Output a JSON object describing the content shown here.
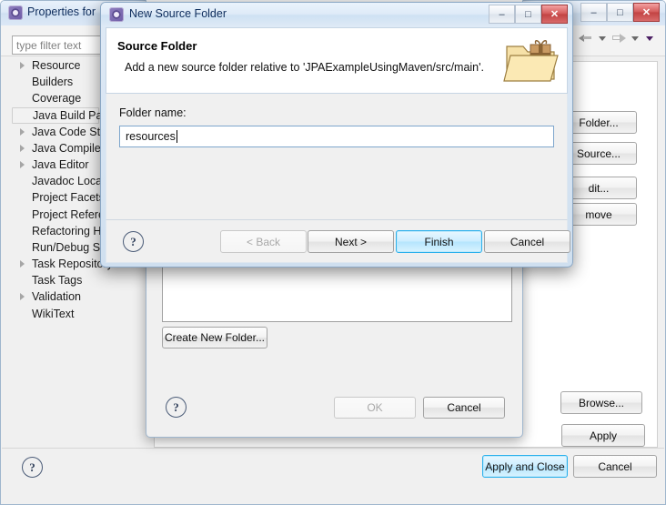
{
  "parent_window": {
    "title": "Properties for",
    "gear_icon": "gear-icon",
    "window_buttons": [
      {
        "name": "minimize",
        "glyph": "–"
      },
      {
        "name": "maximize",
        "glyph": "□"
      },
      {
        "name": "close",
        "glyph": "✕"
      }
    ],
    "toolbar": {
      "back_icon": "back-arrow-icon",
      "back_dropdown_icon": "chevron-down-icon",
      "forward_icon": "forward-arrow-icon",
      "forward_dropdown_icon": "chevron-down-icon",
      "menu_dropdown_icon": "chevron-down-dark-icon"
    },
    "filter": {
      "placeholder": "type filter text",
      "value": ""
    },
    "tree_items": [
      {
        "label": "Resource",
        "expandable": true,
        "selected": false
      },
      {
        "label": "Builders",
        "expandable": false,
        "selected": false
      },
      {
        "label": "Coverage",
        "expandable": false,
        "selected": false
      },
      {
        "label": "Java Build Path",
        "expandable": false,
        "selected": true
      },
      {
        "label": "Java Code Style",
        "expandable": true,
        "selected": false
      },
      {
        "label": "Java Compiler",
        "expandable": true,
        "selected": false
      },
      {
        "label": "Java Editor",
        "expandable": true,
        "selected": false
      },
      {
        "label": "Javadoc Location",
        "expandable": false,
        "selected": false
      },
      {
        "label": "Project Facets",
        "expandable": false,
        "selected": false
      },
      {
        "label": "Project References",
        "expandable": false,
        "selected": false
      },
      {
        "label": "Refactoring History",
        "expandable": false,
        "selected": false
      },
      {
        "label": "Run/Debug Settings",
        "expandable": false,
        "selected": false
      },
      {
        "label": "Task Repository",
        "expandable": true,
        "selected": false
      },
      {
        "label": "Task Tags",
        "expandable": false,
        "selected": false
      },
      {
        "label": "Validation",
        "expandable": true,
        "selected": false
      },
      {
        "label": "WikiText",
        "expandable": false,
        "selected": false
      }
    ],
    "side_buttons": [
      {
        "label": "Add Folder...",
        "visible_text": "Folder..."
      },
      {
        "label": "Link Source...",
        "visible_text": "Source..."
      },
      {
        "label": "Edit...",
        "visible_text": "dit..."
      },
      {
        "label": "Remove",
        "visible_text": "move"
      },
      {
        "label": "Browse...",
        "visible_text": "Browse..."
      },
      {
        "label": "Apply",
        "visible_text": "Apply"
      }
    ],
    "bottom_bar": {
      "help_icon": "help-icon",
      "help_glyph": "?",
      "apply_and_close": "Apply and Close",
      "cancel": "Cancel"
    }
  },
  "folder_selection_dialog": {
    "create_new_folder_button": "Create New Folder...",
    "help_icon": "help-icon",
    "help_glyph": "?",
    "ok_button": "OK",
    "ok_enabled": false,
    "cancel_button": "Cancel"
  },
  "new_source_folder_dialog": {
    "title": "New Source Folder",
    "gear_icon": "gear-icon",
    "window_buttons": [
      {
        "name": "minimize",
        "glyph": "–"
      },
      {
        "name": "maximize",
        "glyph": "□"
      },
      {
        "name": "close",
        "glyph": "✕"
      }
    ],
    "headline": "Source Folder",
    "description": "Add a new source folder relative to 'JPAExampleUsingMaven/src/main'.",
    "banner_icon": "folder-with-gift-icon",
    "folder_name_label": "Folder name:",
    "folder_name_value": "resources",
    "folder_name_placeholder": "",
    "help_icon": "help-icon",
    "help_glyph": "?",
    "buttons": [
      {
        "label": "< Back",
        "state": "disabled"
      },
      {
        "label": "Next >",
        "state": "enabled"
      },
      {
        "label": "Finish",
        "state": "default"
      },
      {
        "label": "Cancel",
        "state": "enabled"
      }
    ]
  },
  "colors": {
    "titlebar_blue": "#cfe0f2",
    "default_button_blue": "#b5e5fd",
    "focus_border": "#2ab0ec",
    "selection_gray": "#f2f2f2",
    "close_red": "#c24343"
  }
}
